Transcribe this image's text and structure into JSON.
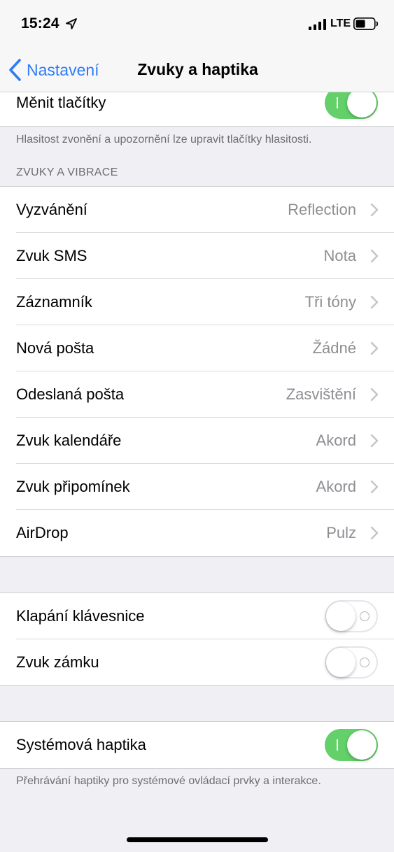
{
  "status_bar": {
    "time": "15:24",
    "network": "LTE"
  },
  "nav": {
    "back_label": "Nastavení",
    "title": "Zvuky a haptika"
  },
  "change_with_buttons": {
    "label": "Měnit tlačítky",
    "on": true
  },
  "volume_note": "Hlasitost zvonění a upozornění lze upravit tlačítky hlasitosti.",
  "sounds_header": "ZVUKY A VIBRACE",
  "sounds": [
    {
      "label": "Vyzvánění",
      "value": "Reflection"
    },
    {
      "label": "Zvuk SMS",
      "value": "Nota"
    },
    {
      "label": "Záznamník",
      "value": "Tři tóny"
    },
    {
      "label": "Nová pošta",
      "value": "Žádné"
    },
    {
      "label": "Odeslaná pošta",
      "value": "Zasvištění"
    },
    {
      "label": "Zvuk kalendáře",
      "value": "Akord"
    },
    {
      "label": "Zvuk připomínek",
      "value": "Akord"
    },
    {
      "label": "AirDrop",
      "value": "Pulz"
    }
  ],
  "keyboard_clicks": {
    "label": "Klapání klávesnice",
    "on": false
  },
  "lock_sound": {
    "label": "Zvuk zámku",
    "on": false
  },
  "system_haptics": {
    "label": "Systémová haptika",
    "on": true
  },
  "haptics_note": "Přehrávání haptiky pro systémové ovládací prvky a interakce.",
  "colors": {
    "accent": "#2f7cf6",
    "toggle_on": "#63d069",
    "background": "#efeff4"
  },
  "icons": [
    "location-arrow-icon",
    "signal-bars-icon",
    "battery-icon",
    "chevron-left-icon",
    "chevron-right-icon"
  ]
}
